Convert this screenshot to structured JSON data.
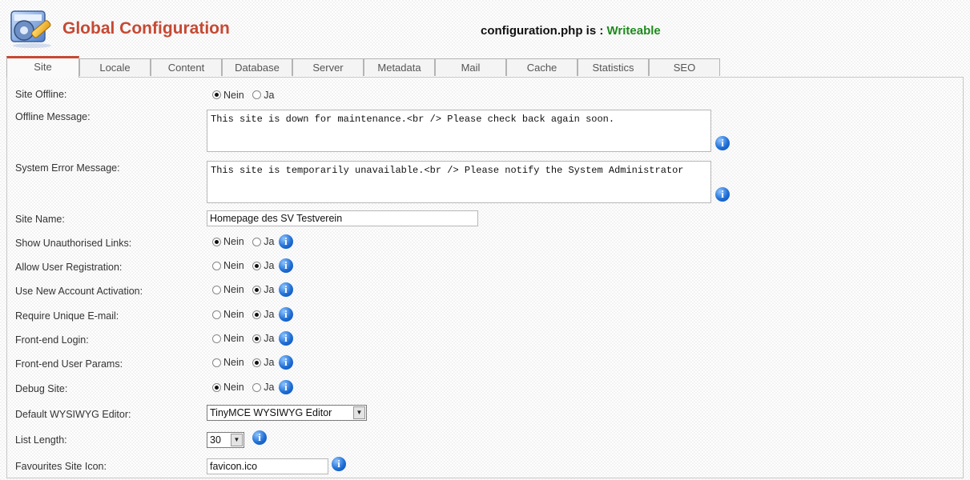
{
  "header": {
    "title": "Global Configuration",
    "status_prefix": "configuration.php is :",
    "status_value": "Writeable"
  },
  "tabs": [
    {
      "label": "Site",
      "active": true
    },
    {
      "label": "Locale"
    },
    {
      "label": "Content"
    },
    {
      "label": "Database"
    },
    {
      "label": "Server"
    },
    {
      "label": "Metadata"
    },
    {
      "label": "Mail"
    },
    {
      "label": "Cache"
    },
    {
      "label": "Statistics"
    },
    {
      "label": "SEO"
    }
  ],
  "radio_labels": {
    "no": "Nein",
    "yes": "Ja"
  },
  "fields": {
    "site_offline": {
      "label": "Site Offline:",
      "value": "Nein"
    },
    "offline_message": {
      "label": "Offline Message:",
      "value": "This site is down for maintenance.<br /> Please check back again soon."
    },
    "system_error_message": {
      "label": "System Error Message:",
      "value": "This site is temporarily unavailable.<br /> Please notify the System Administrator"
    },
    "site_name": {
      "label": "Site Name:",
      "value": "Homepage des SV Testverein"
    },
    "show_unauthorised_links": {
      "label": "Show Unauthorised Links:",
      "value": "Nein"
    },
    "allow_user_registration": {
      "label": "Allow User Registration:",
      "value": "Ja"
    },
    "use_new_account_activation": {
      "label": "Use New Account Activation:",
      "value": "Ja"
    },
    "require_unique_email": {
      "label": "Require Unique E-mail:",
      "value": "Ja"
    },
    "frontend_login": {
      "label": "Front-end Login:",
      "value": "Ja"
    },
    "frontend_user_params": {
      "label": "Front-end User Params:",
      "value": "Ja"
    },
    "debug_site": {
      "label": "Debug Site:",
      "value": "Nein"
    },
    "default_wysiwyg_editor": {
      "label": "Default WYSIWYG Editor:",
      "value": "TinyMCE WYSIWYG Editor"
    },
    "list_length": {
      "label": "List Length:",
      "value": "30"
    },
    "favourites_site_icon": {
      "label": "Favourites Site Icon:",
      "value": "favicon.ico"
    }
  }
}
